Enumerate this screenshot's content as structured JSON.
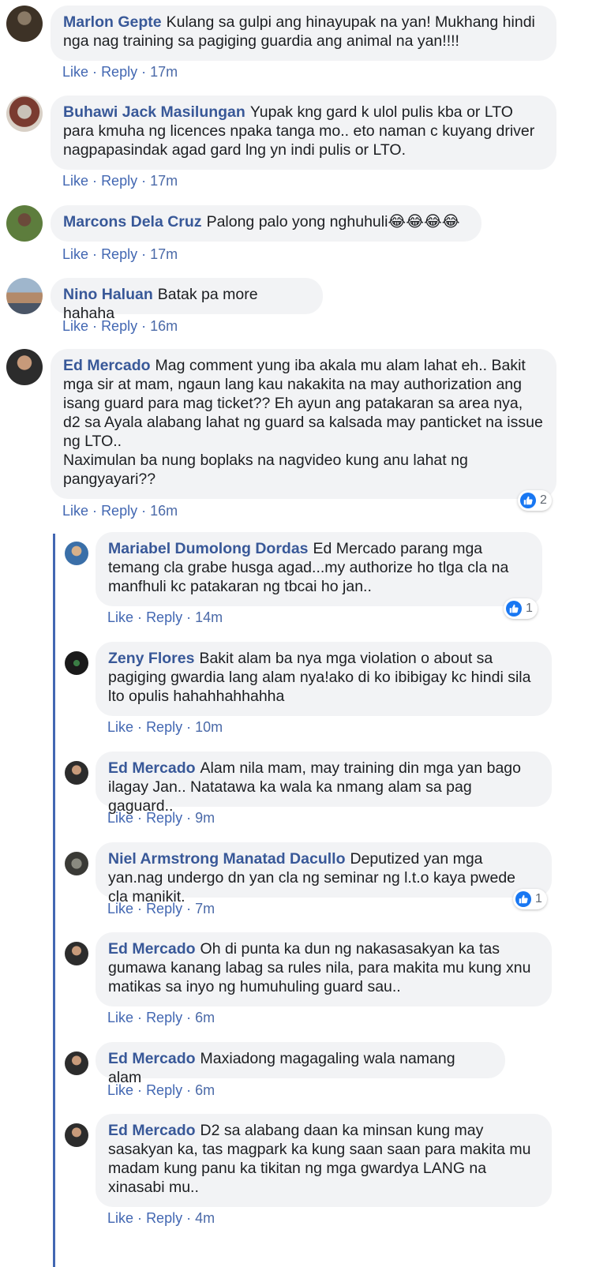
{
  "reaction_color": "#1877f2",
  "name_color": "#385898",
  "action_color": "#4267b2",
  "bubble_color": "#f2f3f5",
  "actions_labels": {
    "like": "Like",
    "reply": "Reply",
    "separator": "·"
  },
  "comments": [
    {
      "name": "Marlon Gepte",
      "text": "Kulang sa gulpi ang hinayupak na yan! Mukhang hindi nga nag training sa pagiging guardia ang animal na yan!!!!",
      "time": "17m",
      "avatar_icon": "avatar-photo"
    },
    {
      "name": "Buhawi Jack Masilungan",
      "text": "Yupak kng gard k ulol pulis kba or LTO para kmuha ng licences npaka tanga mo.. eto naman c kuyang driver nagpapasindak agad gard lng yn indi pulis or LTO.",
      "time": "17m",
      "avatar_icon": "avatar-photo"
    },
    {
      "name": "Marcons Dela Cruz",
      "text": "Palong palo yong nghuhuli",
      "emoji": "😂😂😂😂",
      "time": "17m",
      "avatar_icon": "avatar-photo"
    },
    {
      "name": "Nino Haluan",
      "text": "Batak pa more hahaha",
      "time": "16m",
      "avatar_icon": "avatar-photo"
    },
    {
      "name": "Ed Mercado",
      "text": "Mag comment yung iba akala mu alam lahat eh.. Bakit mga sir at mam, ngaun lang kau nakakita na may authorization ang isang guard para mag ticket?? Eh ayun ang patakaran sa area nya, d2 sa Ayala alabang lahat ng guard sa kalsada may panticket na issue ng LTO..\nNaximulan ba nung boplaks na nagvideo kung anu lahat ng pangyayari??",
      "time": "16m",
      "reactions": "2",
      "avatar_icon": "avatar-photo"
    }
  ],
  "replies": [
    {
      "name": "Mariabel Dumolong Dordas",
      "text": "Ed Mercado parang mga temang cla grabe husga agad...my authorize ho tlga cla na manfhuli kc patakaran ng tbcai ho jan..",
      "time": "14m",
      "reactions": "1",
      "avatar_icon": "avatar-photo"
    },
    {
      "name": "Zeny Flores",
      "text": "Bakit alam ba nya mga violation o about sa pagiging gwardia lang alam nya!ako di ko ibibigay kc hindi sila lto opulis hahahhahhahha",
      "time": "10m",
      "avatar_icon": "avatar-photo"
    },
    {
      "name": "Ed Mercado",
      "text": "Alam nila mam, may training din mga yan bago ilagay Jan.. Natatawa ka wala ka nmang alam sa pag gaguard..",
      "time": "9m",
      "avatar_icon": "avatar-photo"
    },
    {
      "name": "Niel Armstrong Manatad Dacullo",
      "text": "Deputized yan mga yan.nag undergo dn yan cla ng seminar ng l.t.o kaya pwede cla manikit.",
      "time": "7m",
      "reactions": "1",
      "avatar_icon": "avatar-photo"
    },
    {
      "name": "Ed Mercado",
      "text": "Oh di punta ka dun ng nakasasakyan ka tas gumawa kanang labag sa rules nila, para makita mu kung xnu matikas sa inyo ng humuhuling guard sau..",
      "time": "6m",
      "avatar_icon": "avatar-photo"
    },
    {
      "name": "Ed Mercado",
      "text": "Maxiadong magagaling wala namang alam",
      "time": "6m",
      "avatar_icon": "avatar-photo"
    },
    {
      "name": "Ed Mercado",
      "text": "D2 sa alabang daan ka minsan kung may sasakyan ka, tas magpark ka kung saan saan para makita mu madam kung panu ka tikitan ng mga gwardya LANG na xinasabi mu..",
      "time": "4m",
      "avatar_icon": "avatar-photo"
    }
  ]
}
